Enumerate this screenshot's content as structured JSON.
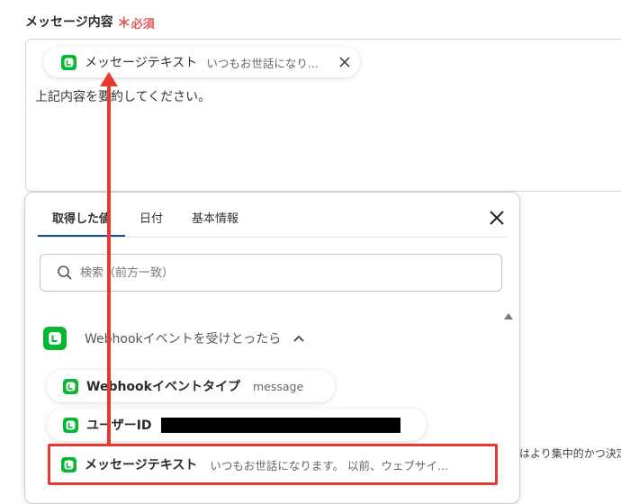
{
  "field": {
    "label": "メッセージ内容",
    "required_star": "＊",
    "required_text": "必須",
    "chip": {
      "name": "メッセージテキスト",
      "value": "いつもお世話になり..."
    },
    "text": "上記内容を要約してください。"
  },
  "panel": {
    "tabs": [
      {
        "label": "取得した値",
        "active": true
      },
      {
        "label": "日付",
        "active": false
      },
      {
        "label": "基本情報",
        "active": false
      }
    ],
    "search_placeholder": "検索（前方一致）",
    "group_title": "Webhookイベントを受けとったら",
    "items": [
      {
        "name": "Webhookイベントタイプ",
        "value": "message"
      },
      {
        "name": "ユーザーID",
        "value": ""
      },
      {
        "name": "メッセージテキスト",
        "value": "いつもお世話になります。 以前、ウェブサイ..."
      }
    ]
  },
  "background_text": "はより集中的かつ決定",
  "colors": {
    "accent_red": "#e8382f",
    "required_red": "#e05a5a",
    "line_green": "#06b734",
    "tab_underline": "#1a4e86"
  },
  "icons": [
    "line-icon",
    "close-icon",
    "search-icon",
    "chevron-up-icon",
    "scroll-up-icon"
  ]
}
